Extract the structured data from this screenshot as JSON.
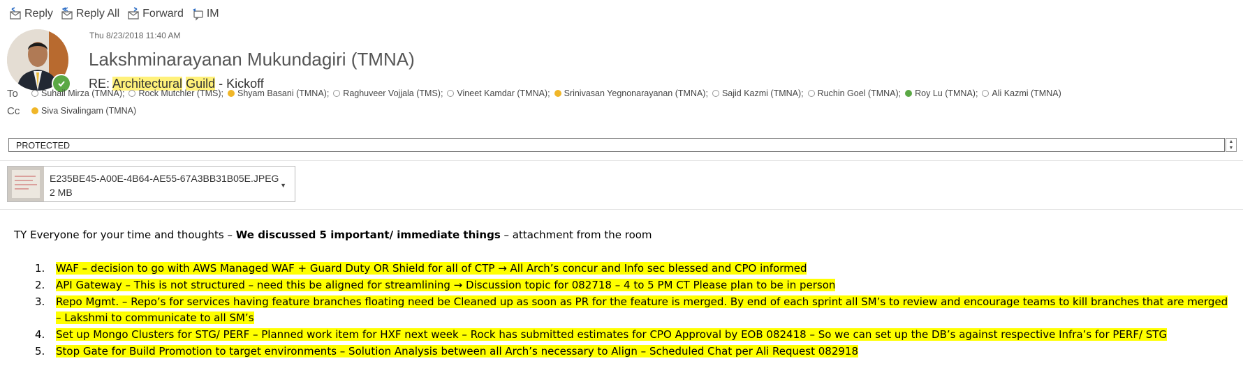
{
  "toolbar": {
    "reply": "Reply",
    "reply_all": "Reply All",
    "forward": "Forward",
    "im": "IM"
  },
  "header": {
    "date": "Thu 8/23/2018 11:40 AM",
    "sender": "Lakshminarayanan Mukundagiri (TMNA)",
    "subject_prefix": "RE: ",
    "subject_hl1": "Architectural",
    "subject_hl2": "Guild",
    "subject_rest": " - Kickoff"
  },
  "to_label": "To",
  "cc_label": "Cc",
  "to": [
    {
      "name": "Suhail Mirza (TMNA);",
      "status": "offline"
    },
    {
      "name": "Rock Mutchler (TMS);",
      "status": "offline"
    },
    {
      "name": "Shyam Basani (TMNA);",
      "status": "away"
    },
    {
      "name": "Raghuveer Vojjala (TMS);",
      "status": "offline"
    },
    {
      "name": "Vineet Kamdar (TMNA);",
      "status": "offline"
    },
    {
      "name": "Srinivasan Yegnonarayanan (TMNA);",
      "status": "away"
    },
    {
      "name": "Sajid Kazmi (TMNA);",
      "status": "offline"
    },
    {
      "name": "Ruchin Goel (TMNA);",
      "status": "offline"
    },
    {
      "name": "Roy Lu (TMNA);",
      "status": "online"
    },
    {
      "name": "Ali Kazmi (TMNA)",
      "status": "offline"
    }
  ],
  "cc": [
    {
      "name": "Siva Sivalingam (TMNA)",
      "status": "away"
    }
  ],
  "classification": "PROTECTED",
  "attachment": {
    "filename": "E235BE45-A00E-4B64-AE55-67A3BB31B05E.JPEG",
    "size": "2 MB"
  },
  "body": {
    "intro_a": "TY Everyone for your time and thoughts – ",
    "intro_b": "We discussed 5 important/ immediate things",
    "intro_c": " – attachment from the room",
    "items": [
      {
        "num": "1.",
        "text": "WAF – decision to go with AWS Managed WAF + Guard Duty  OR Shield for all of CTP → All Arch’s concur and Info sec blessed and CPO informed"
      },
      {
        "num": "2.",
        "text": "API Gateway – This is not structured – need this be aligned for streamlining → Discussion topic for 082718 – 4 to 5 PM CT Please plan to be in person"
      },
      {
        "num": "3.",
        "text": "Repo Mgmt. – Repo’s for services having feature branches floating need be Cleaned up as soon as PR for the feature is merged. By end of each sprint all SM’s to review and encourage teams to kill branches that are merged – Lakshmi to communicate to all SM’s"
      },
      {
        "num": "4.",
        "text": "Set up Mongo Clusters for STG/ PERF – Planned work item for HXF next week – Rock has submitted estimates for CPO Approval by EOB 082418 – So we can set up the DB’s against respective Infra’s for PERF/ STG"
      },
      {
        "num": "5.",
        "text": "Stop Gate for Build Promotion to target environments – Solution Analysis between all Arch’s necessary to Align – Scheduled Chat per Ali Request 082918"
      }
    ]
  }
}
